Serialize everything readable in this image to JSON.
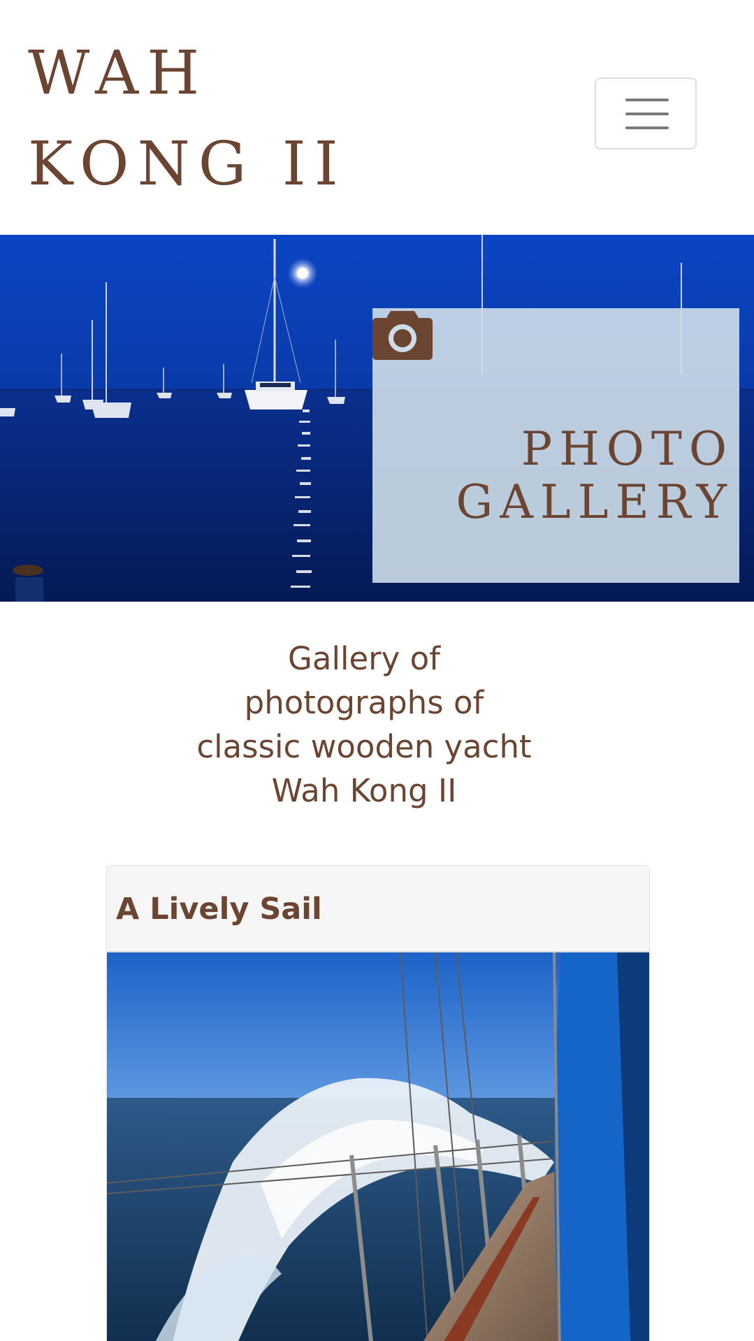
{
  "header": {
    "brand_line1": "WAH",
    "brand_line2": "KONG II",
    "menu_toggle_icon": "hamburger-menu-icon"
  },
  "hero": {
    "icon": "camera-icon",
    "title_line1": "PHOTO",
    "title_line2": "GALLERY"
  },
  "intro": {
    "text": "Gallery of photographs of classic wooden yacht Wah Kong II"
  },
  "gallery": {
    "items": [
      {
        "title": "A Lively Sail"
      }
    ]
  },
  "colors": {
    "brand_brown": "#6b4532",
    "hero_panel": "#cedee8",
    "night_blue": "#0a3aa8"
  }
}
